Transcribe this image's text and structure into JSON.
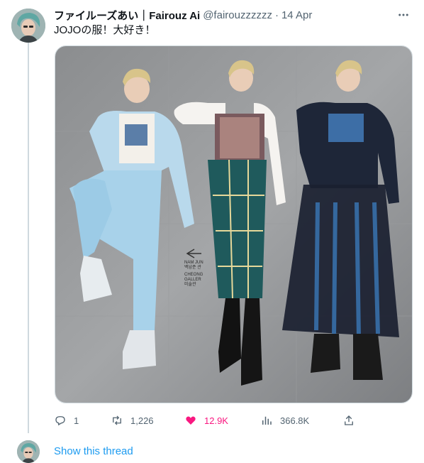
{
  "tweet": {
    "author": {
      "display_name": "ファイルーズあい｜Fairouz Ai",
      "handle": "@fairouzzzzzz",
      "separator": "·",
      "time": "14 Apr"
    },
    "text": "JOJOの服！大好き！",
    "media": {
      "type": "photo",
      "signage_lines": [
        "NAM JUN",
        "백남준 관",
        "CHEONG",
        "GALLER",
        "미술관"
      ]
    },
    "actions": {
      "reply": {
        "icon": "reply-icon",
        "count": "1"
      },
      "retweet": {
        "icon": "retweet-icon",
        "count": "1,226"
      },
      "like": {
        "icon": "heart-icon",
        "count": "12.9K",
        "liked": true,
        "color": "#f91880"
      },
      "views": {
        "icon": "views-icon",
        "count": "366.8K"
      },
      "share": {
        "icon": "share-icon"
      }
    }
  },
  "thread": {
    "show_label": "Show this thread",
    "link_color": "#1d9bf0"
  }
}
